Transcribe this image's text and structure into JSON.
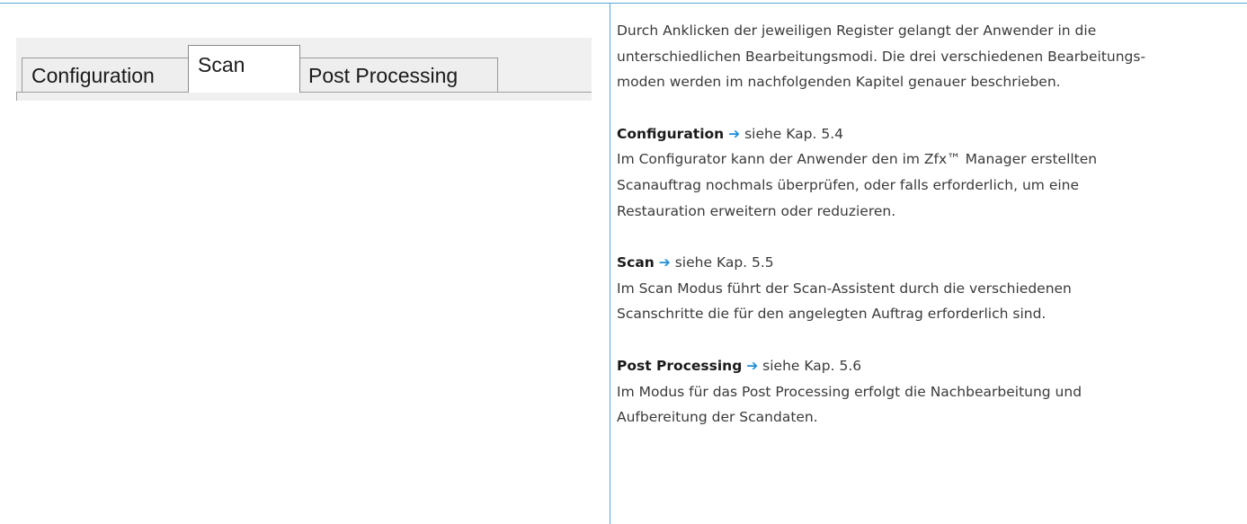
{
  "tabs": [
    {
      "label": "Configuration",
      "active": false
    },
    {
      "label": "Scan",
      "active": true
    },
    {
      "label": "Post Processing",
      "active": false
    }
  ],
  "intro": {
    "lines": [
      "Durch Anklicken der jeweiligen Register gelangt der Anwender in die",
      "unterschiedlichen Bearbeitungsmodi. Die drei verschiedenen Bearbeitungs-",
      "moden werden im nachfolgenden Kapitel genauer beschrieben."
    ]
  },
  "sections": [
    {
      "title": "Configuration",
      "arrow": "➔",
      "ref": "siehe Kap. 5.4",
      "lines": [
        "Im Configurator kann der Anwender den im Zfx™ Manager erstellten",
        "Scanauftrag nochmals überprüfen, oder falls erforderlich, um eine",
        "Restauration erweitern oder reduzieren."
      ]
    },
    {
      "title": "Scan",
      "arrow": "➔",
      "ref": "siehe Kap. 5.5",
      "lines": [
        "Im Scan Modus führt der Scan-Assistent durch die verschiedenen",
        "Scanschritte die für den angelegten Auftrag erforderlich sind."
      ]
    },
    {
      "title": "Post Processing",
      "arrow": "➔",
      "ref": "siehe Kap. 5.6",
      "lines": [
        "Im Modus für das Post Processing erfolgt die Nachbearbeitung und",
        "Aufbereitung der Scandaten."
      ]
    }
  ],
  "colors": {
    "rule": "#5aa7d6",
    "arrow": "#1f8fd8"
  }
}
